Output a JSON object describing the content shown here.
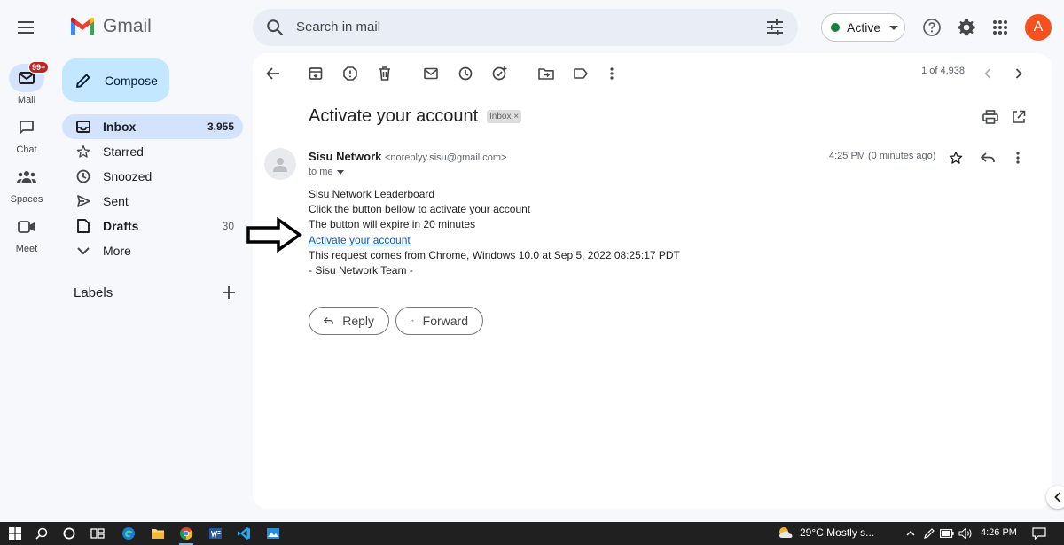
{
  "header": {
    "app_name": "Gmail",
    "search_placeholder": "Search in mail",
    "status_label": "Active",
    "avatar_initial": "A"
  },
  "rail": {
    "mail_label": "Mail",
    "mail_badge": "99+",
    "chat_label": "Chat",
    "spaces_label": "Spaces",
    "meet_label": "Meet"
  },
  "nav": {
    "compose_label": "Compose",
    "items": [
      {
        "label": "Inbox",
        "count": "3,955"
      },
      {
        "label": "Starred",
        "count": ""
      },
      {
        "label": "Snoozed",
        "count": ""
      },
      {
        "label": "Sent",
        "count": ""
      },
      {
        "label": "Drafts",
        "count": "30"
      },
      {
        "label": "More",
        "count": ""
      }
    ],
    "labels_heading": "Labels"
  },
  "toolbar": {
    "pager": "1 of 4,938"
  },
  "email": {
    "subject": "Activate your account",
    "label_chip": "Inbox",
    "sender_name": "Sisu Network",
    "sender_address": "<noreplyy.sisu@gmail.com>",
    "to": "to me",
    "time": "4:25 PM (0 minutes ago)",
    "body_lines": [
      "Sisu Network Leaderboard",
      "Click the button bellow to activate your account",
      "The button will expire in 20 minutes"
    ],
    "link_text": "Activate your account",
    "request_line": "This request comes from Chrome, Windows 10.0 at Sep 5, 2022 08:25:17 PDT",
    "signature": "- Sisu Network Team -",
    "reply_label": "Reply",
    "forward_label": "Forward"
  },
  "taskbar": {
    "weather": "29°C  Mostly s...",
    "clock": "4:26 PM"
  },
  "colors": {
    "brand_blue": "#0b57d0",
    "compose_bg": "#c2e7ff",
    "active_nav": "#d3e3fd",
    "status_green": "#188038",
    "avatar": "#f4511e",
    "link": "#1155cc"
  }
}
